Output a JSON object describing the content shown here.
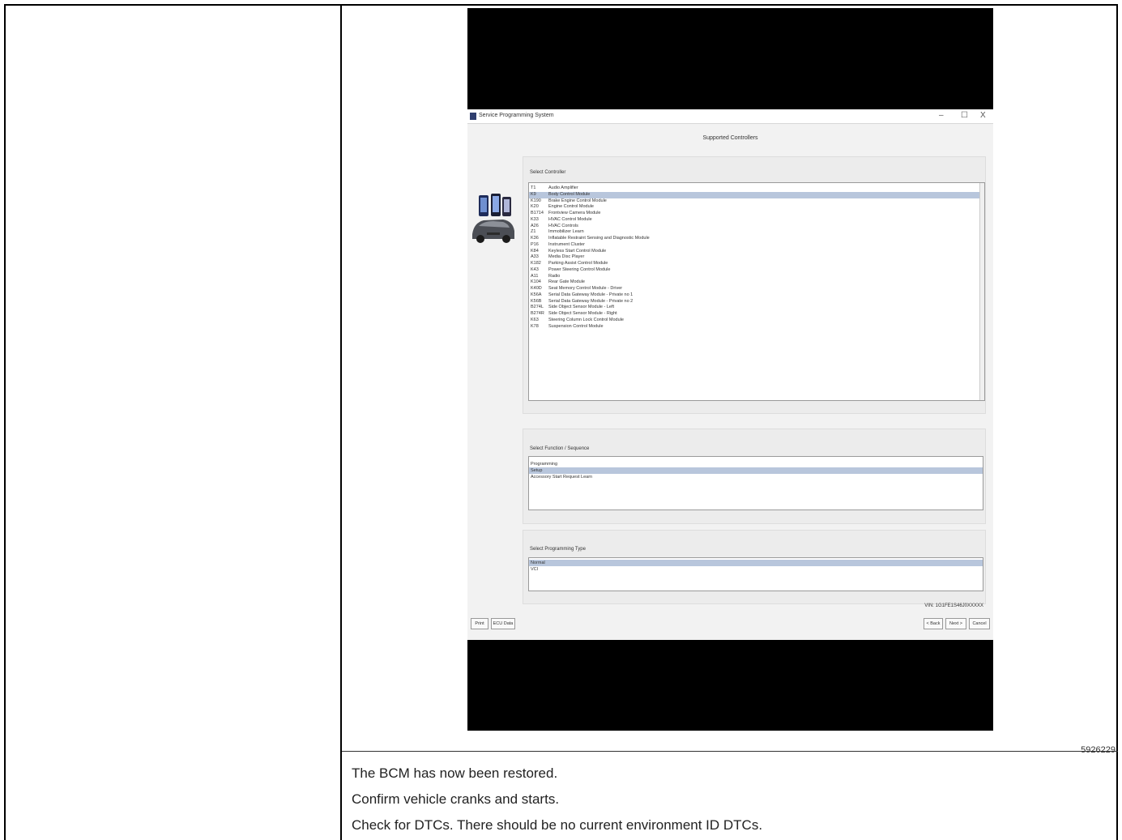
{
  "figure": {
    "id": "5926229",
    "app_title": "Service Programming System",
    "window_controls": {
      "minimize": "–",
      "maximize": "☐",
      "close": "X"
    },
    "page_heading": "Supported Controllers",
    "controller_panel": {
      "label": "Select Controller",
      "rows": [
        {
          "code": "T1",
          "name": "Audio Amplifier",
          "selected": false
        },
        {
          "code": "K9",
          "name": "Body Control Module",
          "selected": true
        },
        {
          "code": "K190",
          "name": "Brake Engine Control Module",
          "selected": false
        },
        {
          "code": "K20",
          "name": "Engine Control Module",
          "selected": false
        },
        {
          "code": "B1714",
          "name": "Frontview Camera Module",
          "selected": false
        },
        {
          "code": "K33",
          "name": "HVAC Control Module",
          "selected": false
        },
        {
          "code": "A26",
          "name": "HVAC Controls",
          "selected": false
        },
        {
          "code": "Z1",
          "name": "Immobilizer Learn",
          "selected": false
        },
        {
          "code": "K36",
          "name": "Inflatable Restraint Sensing and Diagnostic Module",
          "selected": false
        },
        {
          "code": "P16",
          "name": "Instrument Cluster",
          "selected": false
        },
        {
          "code": "K84",
          "name": "Keyless Start Control Module",
          "selected": false
        },
        {
          "code": "A33",
          "name": "Media Disc Player",
          "selected": false
        },
        {
          "code": "K182",
          "name": "Parking Assist Control Module",
          "selected": false
        },
        {
          "code": "K43",
          "name": "Power Steering Control Module",
          "selected": false
        },
        {
          "code": "A11",
          "name": "Radio",
          "selected": false
        },
        {
          "code": "K104",
          "name": "Rear Gate Module",
          "selected": false
        },
        {
          "code": "K40D",
          "name": "Seat Memory Control Module - Driver",
          "selected": false
        },
        {
          "code": "K56A",
          "name": "Serial Data Gateway Module - Private no 1",
          "selected": false
        },
        {
          "code": "K56B",
          "name": "Serial Data Gateway Module - Private no 2",
          "selected": false
        },
        {
          "code": "B274L",
          "name": "Side Object Sensor Module - Left",
          "selected": false
        },
        {
          "code": "B274R",
          "name": "Side Object Sensor Module - Right",
          "selected": false
        },
        {
          "code": "K63",
          "name": "Steering Column Lock Control Module",
          "selected": false
        },
        {
          "code": "K78",
          "name": "Suspension Control Module",
          "selected": false
        }
      ]
    },
    "function_panel": {
      "label": "Select Function / Sequence",
      "rows": [
        {
          "name": "Programming",
          "selected": false
        },
        {
          "name": "Setup",
          "selected": true
        },
        {
          "name": "Accessory Start Request Learn",
          "selected": false
        }
      ]
    },
    "type_panel": {
      "label": "Select Programming Type",
      "rows": [
        {
          "name": "Normal",
          "selected": true
        },
        {
          "name": "VCI",
          "selected": false
        }
      ]
    },
    "vin": "VIN: 1G1FE1S46J0XXXXX",
    "buttons": {
      "print": "Print",
      "ecu_data": "ECU Data",
      "back": "< Back",
      "next": "Next >",
      "cancel": "Cancel"
    }
  },
  "body_text": [
    "The BCM has now been restored.",
    "Confirm vehicle cranks and starts.",
    "Check for DTCs. There should be no current environment ID DTCs."
  ],
  "colors": {
    "selection": "#b8c6dc",
    "frame": "#000000",
    "app_bg": "#f2f2f2"
  }
}
